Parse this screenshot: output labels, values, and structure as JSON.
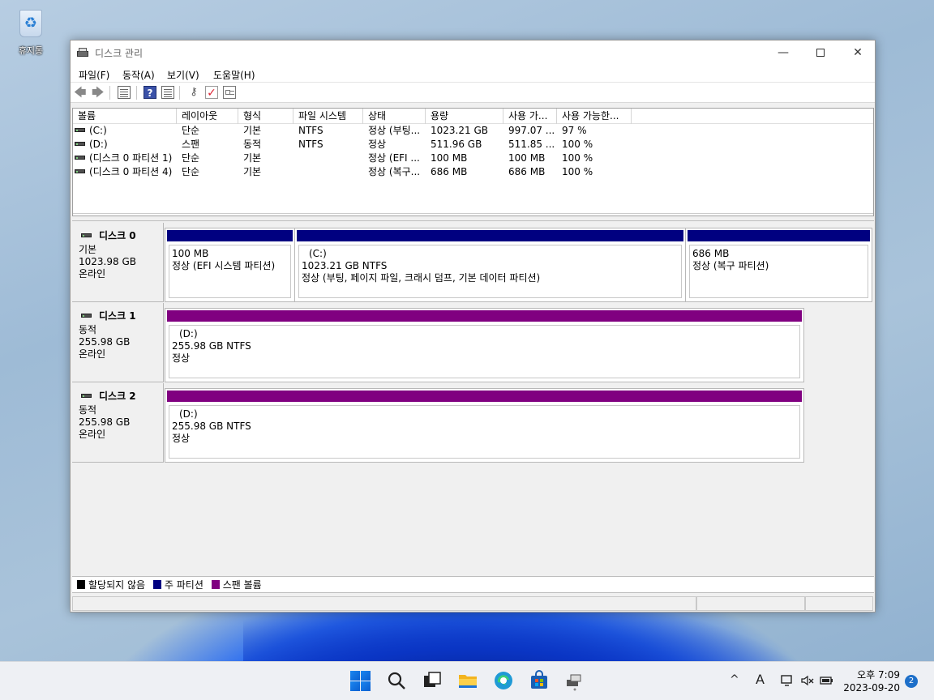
{
  "desktop": {
    "recycle_bin_label": "휴지통"
  },
  "window": {
    "title": "디스크 관리",
    "controls": {
      "minimize": "—",
      "close": "✕"
    }
  },
  "menu": [
    "파일(F)",
    "동작(A)",
    "보기(V)",
    "도움말(H)"
  ],
  "toolbar": {
    "icons": [
      "back-icon",
      "forward-icon",
      "volume-list-icon",
      "help-icon",
      "graphical-view-icon",
      "connect-icon",
      "check-icon",
      "properties-icon"
    ]
  },
  "volume_list": {
    "columns": [
      "볼륨",
      "레이아웃",
      "형식",
      "파일 시스템",
      "상태",
      "용량",
      "사용 가...",
      "사용 가능한..."
    ],
    "rows": [
      [
        "(C:)",
        "단순",
        "기본",
        "NTFS",
        "정상 (부팅...",
        "1023.21 GB",
        "997.07 ...",
        "97 %"
      ],
      [
        "(D:)",
        "스팬",
        "동적",
        "NTFS",
        "정상",
        "511.96 GB",
        "511.85 ...",
        "100 %"
      ],
      [
        "(디스크 0 파티션 1)",
        "단순",
        "기본",
        "",
        "정상 (EFI ...",
        "100 MB",
        "100 MB",
        "100 %"
      ],
      [
        "(디스크 0 파티션 4)",
        "단순",
        "기본",
        "",
        "정상 (복구...",
        "686 MB",
        "686 MB",
        "100 %"
      ]
    ]
  },
  "disks": [
    {
      "name": "디스크 0",
      "type": "기본",
      "size": "1023.98 GB",
      "status": "온라인",
      "partitions": [
        {
          "name": "",
          "line1": "100 MB",
          "line2": "정상 (EFI 시스템 파티션)",
          "color": "#000080"
        },
        {
          "name": "(C:)",
          "line1": "1023.21 GB NTFS",
          "line2": "정상 (부팅, 페이지 파일, 크래시 덤프, 기본 데이터 파티션)",
          "color": "#000080"
        },
        {
          "name": "",
          "line1": "686 MB",
          "line2": "정상 (복구 파티션)",
          "color": "#000080"
        }
      ]
    },
    {
      "name": "디스크 1",
      "type": "동적",
      "size": "255.98 GB",
      "status": "온라인",
      "partitions": [
        {
          "name": "(D:)",
          "line1": "255.98 GB NTFS",
          "line2": "정상",
          "color": "#800080"
        }
      ]
    },
    {
      "name": "디스크 2",
      "type": "동적",
      "size": "255.98 GB",
      "status": "온라인",
      "partitions": [
        {
          "name": "(D:)",
          "line1": "255.98 GB NTFS",
          "line2": "정상",
          "color": "#800080"
        }
      ]
    }
  ],
  "legend": [
    {
      "label": "할당되지 않음",
      "color": "#000000"
    },
    {
      "label": "주 파티션",
      "color": "#000080"
    },
    {
      "label": "스팬 볼륨",
      "color": "#800080"
    }
  ],
  "taskbar": {
    "apps": [
      "start-icon",
      "search-icon",
      "task-view-icon",
      "file-explorer-icon",
      "edge-icon",
      "store-icon",
      "disk-management-icon"
    ],
    "tray": {
      "chevron": "^",
      "ime": "A"
    },
    "clock": {
      "time": "오후 7:09",
      "date": "2023-09-20"
    },
    "notification_count": "2"
  }
}
